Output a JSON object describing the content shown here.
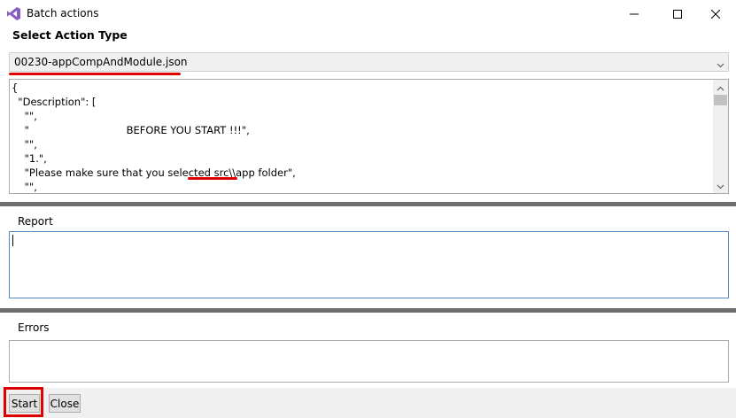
{
  "window": {
    "title": "Batch actions"
  },
  "header": {
    "heading": "Select Action Type"
  },
  "action_type": {
    "selected": "00230-appCompAndModule.json"
  },
  "json_preview": {
    "lines": [
      "{",
      "  \"Description\": [",
      "    \"\",",
      "    \"                              BEFORE YOU START !!!\",",
      "    \"\",",
      "    \"1.\",",
      "    \"Please make sure that you selected src\\\\app folder\",",
      "    \"\","
    ]
  },
  "report": {
    "label": "Report",
    "value": ""
  },
  "errors": {
    "label": "Errors",
    "value": ""
  },
  "buttons": {
    "start": "Start",
    "close": "Close"
  },
  "icons": {
    "app": "visual-studio-icon",
    "minimize": "minimize-icon",
    "maximize": "maximize-icon",
    "close": "close-icon",
    "dropdown": "chevron-down-icon",
    "scroll_up": "chevron-up-icon",
    "scroll_down": "chevron-down-icon"
  },
  "colors": {
    "annotation_red": "#e00000",
    "focus_border": "#4f89c8",
    "splitter": "#6d6d6d",
    "app_icon": "#865fc5"
  }
}
